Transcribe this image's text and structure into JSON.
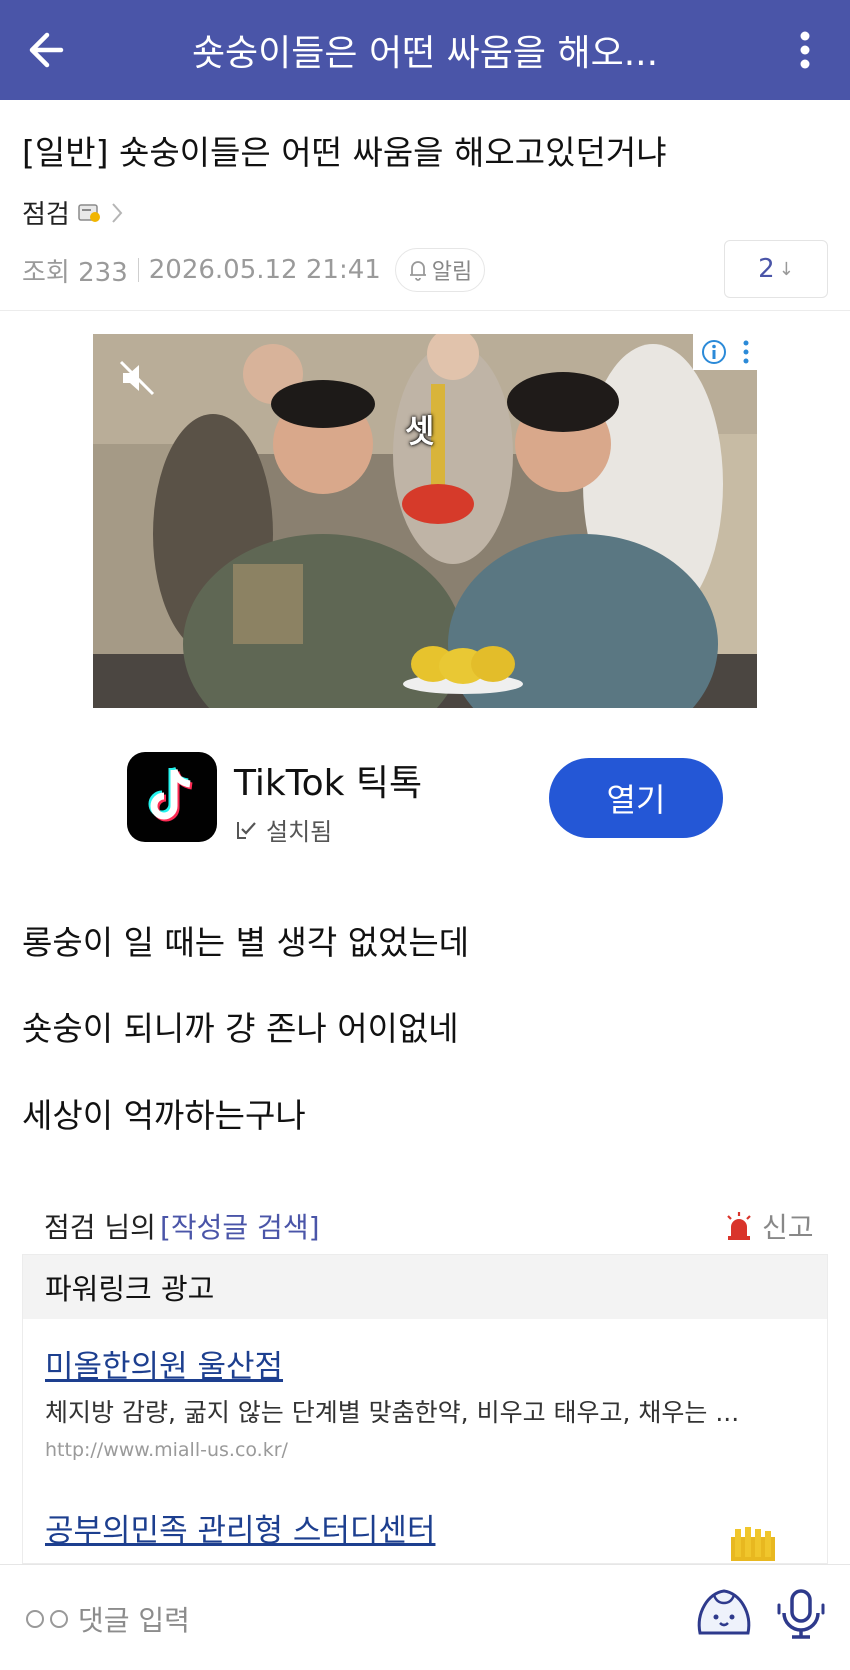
{
  "appbar": {
    "title": "숏숭이들은 어떤 싸움을 해오...",
    "back_icon": "arrow-left-icon",
    "more_icon": "more-vertical-icon",
    "color": "#4a55a8"
  },
  "post": {
    "title": "[일반] 숏숭이들은 어떤 싸움을 해오고있던거냐",
    "author": "점검",
    "views_label": "조회 233",
    "datetime": "2026.05.12 21:41",
    "alarm_label": "알림",
    "comment_count": "2",
    "comment_arrow": "↓"
  },
  "ad": {
    "caption": "셋",
    "app_name": "TikTok 틱톡",
    "app_status": "설치됨",
    "open_label": "열기",
    "button_color": "#2457d6"
  },
  "body": {
    "lines": [
      "롱숭이 일 때는 별 생각 없었는데",
      "숏숭이 되니까 걍 존나 어이없네",
      "세상이 억까하는구나"
    ]
  },
  "author_search": {
    "prefix": "점검 님의",
    "link": "[작성글 검색]",
    "report_label": "신고",
    "report_color": "#d9342b"
  },
  "powerlink": {
    "header": "파워링크 광고",
    "items": [
      {
        "title": "미올한의원 울산점",
        "desc": "체지방 감량, 굶지 않는 단계별 맞춤한약, 비우고 태우고, 채우는 ...",
        "url": "http://www.miall-us.co.kr/"
      },
      {
        "title": "공부의민족 관리형 스터디센터"
      }
    ]
  },
  "comment_bar": {
    "placeholder": "댓글 입력"
  }
}
